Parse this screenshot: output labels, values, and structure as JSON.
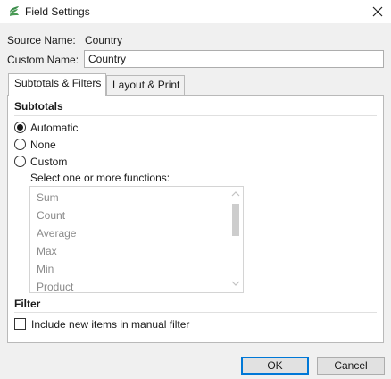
{
  "window": {
    "title": "Field Settings",
    "app_icon": "app-logo-icon",
    "close_icon": "close-icon",
    "accent_color": "#3a8c4a"
  },
  "source": {
    "label": "Source Name:",
    "value": "Country"
  },
  "custom": {
    "label": "Custom Name:",
    "value": "Country"
  },
  "tabs": [
    {
      "label": "Subtotals & Filters",
      "active": true
    },
    {
      "label": "Layout & Print",
      "active": false
    }
  ],
  "subtotals": {
    "title": "Subtotals",
    "options": [
      {
        "label": "Automatic",
        "checked": true
      },
      {
        "label": "None",
        "checked": false
      },
      {
        "label": "Custom",
        "checked": false
      }
    ],
    "functions_label": "Select one or more functions:",
    "functions": [
      "Sum",
      "Count",
      "Average",
      "Max",
      "Min",
      "Product"
    ]
  },
  "filter": {
    "title": "Filter",
    "checkbox_label": "Include new items in manual filter",
    "checked": false
  },
  "buttons": {
    "ok": "OK",
    "cancel": "Cancel"
  }
}
